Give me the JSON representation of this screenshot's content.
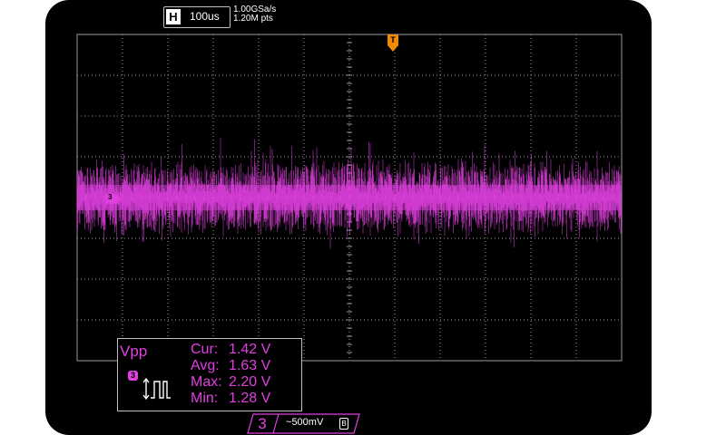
{
  "header": {
    "timebase_tag": "H",
    "timebase_value": "100us",
    "sample_rate": "1.00GSa/s",
    "memory_depth": "1.20M pts"
  },
  "trigger": {
    "marker_label": "T"
  },
  "channel": {
    "marker_label": "3",
    "number": "3",
    "coupling_symbol": "~",
    "scale": "500mV",
    "bandwidth_icon": "bandwidth-limit-icon",
    "color": "#e040e0"
  },
  "measurement": {
    "name": "Vpp",
    "channel_badge": "3",
    "rows": [
      {
        "label": "Cur:",
        "value": "1.42 V"
      },
      {
        "label": "Avg:",
        "value": "1.63 V"
      },
      {
        "label": "Max:",
        "value": "2.20 V"
      },
      {
        "label": "Min:",
        "value": "1.28 V"
      }
    ]
  },
  "colors": {
    "trace": "#e040e0",
    "trigger": "#f08a00",
    "grid": "#9a9a9a",
    "background": "#000000"
  }
}
